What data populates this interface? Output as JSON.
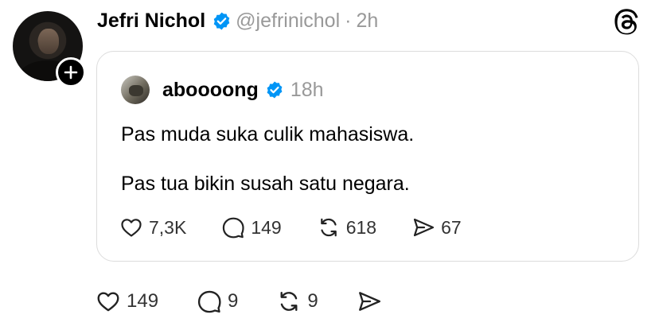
{
  "post": {
    "author_name": "Jefri Nichol",
    "handle": "@jefrinichol",
    "separator": "·",
    "time": "2h",
    "actions": {
      "like_count": "149",
      "reply_count": "9",
      "repost_count": "9"
    }
  },
  "quote": {
    "author_name": "aboooong",
    "time": "18h",
    "lines": [
      "Pas muda suka culik mahasiswa.",
      "Pas tua bikin susah satu negara."
    ],
    "actions": {
      "like_count": "7,3K",
      "reply_count": "149",
      "repost_count": "618",
      "share_count": "67"
    }
  },
  "colors": {
    "verified": "#0095f6",
    "secondary_text": "#999999",
    "card_border": "#dcdcdc"
  },
  "icons": [
    "plus-icon",
    "verified-icon",
    "threads-logo-icon",
    "heart-icon",
    "comment-icon",
    "repost-icon",
    "share-icon"
  ]
}
